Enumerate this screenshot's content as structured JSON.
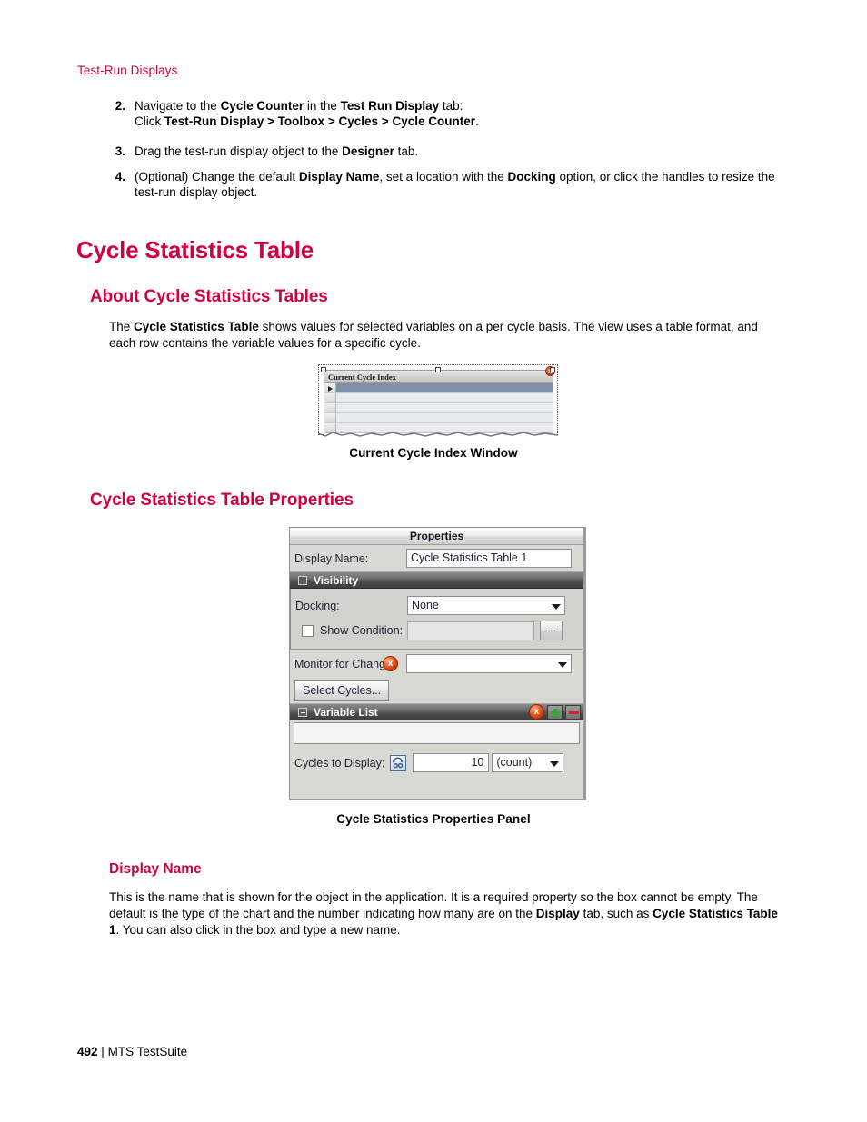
{
  "page": {
    "running_header": "Test-Run Displays",
    "footer_page_number": "492",
    "footer_separator": "|",
    "footer_title": "MTS TestSuite",
    "accent_color": "#d1003f"
  },
  "steps": [
    {
      "number": "2.",
      "parts": [
        {
          "text": "Navigate to the ",
          "bold": false
        },
        {
          "text": "Cycle Counter",
          "bold": true
        },
        {
          "text": " in the ",
          "bold": false
        },
        {
          "text": "Test Run Display",
          "bold": true
        },
        {
          "text": " tab:",
          "bold": false
        }
      ],
      "sub_parts": [
        {
          "text": "Click ",
          "bold": false
        },
        {
          "text": "Test-Run Display > Toolbox > Cycles > Cycle Counter",
          "bold": true
        },
        {
          "text": ".",
          "bold": false
        }
      ]
    },
    {
      "number": "3.",
      "parts": [
        {
          "text": "Drag the test-run display object to the ",
          "bold": false
        },
        {
          "text": "Designer",
          "bold": true
        },
        {
          "text": " tab.",
          "bold": false
        }
      ]
    },
    {
      "number": "4.",
      "parts": [
        {
          "text": "(Optional) Change the default ",
          "bold": false
        },
        {
          "text": "Display Name",
          "bold": true
        },
        {
          "text": ", set a location with the ",
          "bold": false
        },
        {
          "text": "Docking",
          "bold": true
        },
        {
          "text": " option, or click the handles to resize the test-run display object.",
          "bold": false
        }
      ]
    }
  ],
  "headings": {
    "h1_cycle_statistics_table": "Cycle Statistics Table",
    "h2_about": "About Cycle Statistics Tables",
    "h2_properties": "Cycle Statistics Table Properties",
    "h3_display_name": "Display Name"
  },
  "paragraphs": {
    "about_body": [
      {
        "text": "The ",
        "bold": false
      },
      {
        "text": "Cycle Statistics Table",
        "bold": true
      },
      {
        "text": " shows values for selected variables on a per cycle basis. The view uses a table format, and each row contains the variable values for a specific cycle.",
        "bold": false
      }
    ],
    "display_name_body": [
      {
        "text": "This is the name that is shown for the object in the application. It is a required property so the box cannot be empty. The default is the type of the chart and the number indicating how many are on the ",
        "bold": false
      },
      {
        "text": "Display",
        "bold": true
      },
      {
        "text": " tab, such as ",
        "bold": false
      },
      {
        "text": "Cycle Statistics Table 1",
        "bold": true
      },
      {
        "text": ". You can also click in the box and type a new name.",
        "bold": false
      }
    ]
  },
  "figures": {
    "current_cycle_index": {
      "caption": "Current Cycle Index Window",
      "window_title": "Current Cycle Index",
      "close_glyph": "x"
    },
    "properties_panel": {
      "caption": "Cycle Statistics Properties Panel",
      "title": "Properties",
      "display_name_label": "Display Name:",
      "display_name_value": "Cycle Statistics Table 1",
      "visibility_group_label": "Visibility",
      "docking_label": "Docking:",
      "docking_value": "None",
      "show_condition_label": "Show Condition:",
      "show_condition_value": "",
      "ellipsis_button_label": "...",
      "monitor_for_change_label": "Monitor for Change:",
      "monitor_for_change_value": "",
      "select_cycles_button": "Select Cycles...",
      "variable_list_group_label": "Variable List",
      "variable_list_value": "",
      "cycles_to_display_label": "Cycles to Display:",
      "cycles_to_display_value": "10",
      "cycles_to_display_units": "(count)",
      "error_glyph": "x"
    }
  }
}
